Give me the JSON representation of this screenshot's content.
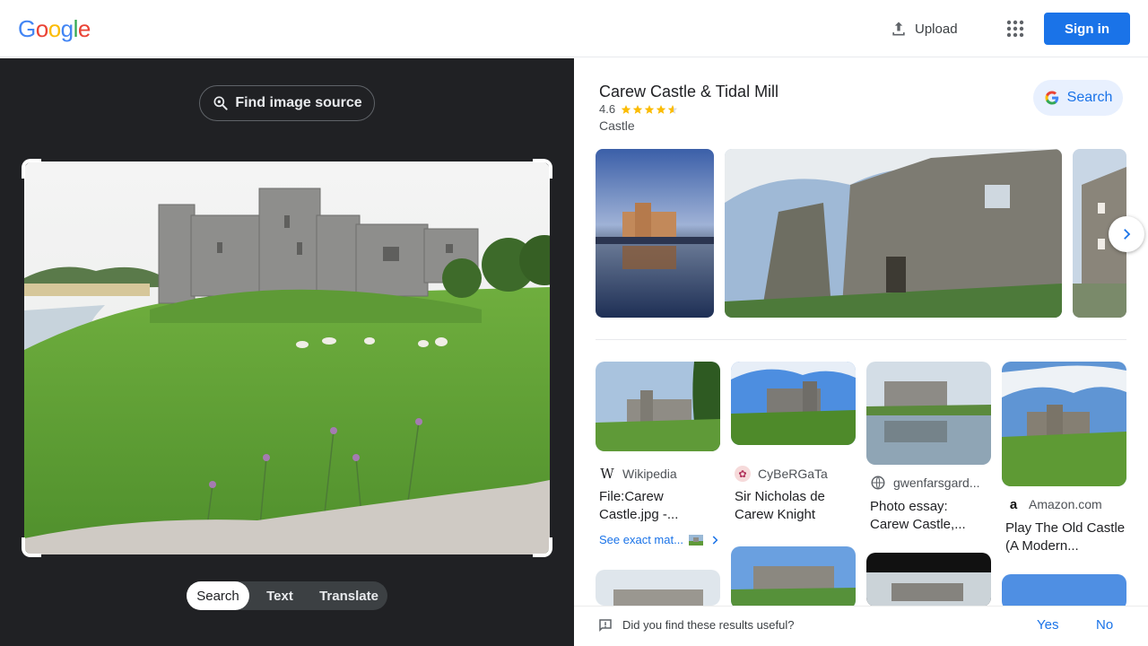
{
  "header": {
    "logo_letters": [
      "G",
      "o",
      "o",
      "g",
      "l",
      "e"
    ],
    "logo_colors": [
      "#4285F4",
      "#EA4335",
      "#FBBC05",
      "#4285F4",
      "#34A853",
      "#EA4335"
    ],
    "upload_label": "Upload",
    "signin_label": "Sign in",
    "apps_icon": "apps-grid-icon"
  },
  "left_panel": {
    "find_source_label": "Find image source",
    "mode_tabs": [
      {
        "label": "Search",
        "active": true
      },
      {
        "label": "Text",
        "active": false
      },
      {
        "label": "Translate",
        "active": false
      }
    ]
  },
  "knowledge_panel": {
    "title": "Carew Castle & Tidal Mill",
    "rating": "4.6",
    "stars": 4.6,
    "type": "Castle",
    "search_label": "Search"
  },
  "results": [
    {
      "source": "Wikipedia",
      "title": "File:Carew Castle.jpg -..."
    },
    {
      "source": "CyBeRGaTa",
      "title": "Sir Nicholas de Carew Knight"
    },
    {
      "source": "gwenfarsgard...",
      "title": "Photo essay: Carew Castle,..."
    },
    {
      "source": "Amazon.com",
      "title": "Play The Old Castle (A Modern..."
    }
  ],
  "see_exact_label": "See exact mat...",
  "feedback": {
    "question": "Did you find these results useful?",
    "yes_label": "Yes",
    "no_label": "No"
  },
  "colors": {
    "accent": "#1a73e8",
    "dark_panel": "#202124",
    "star": "#fbbc04"
  }
}
